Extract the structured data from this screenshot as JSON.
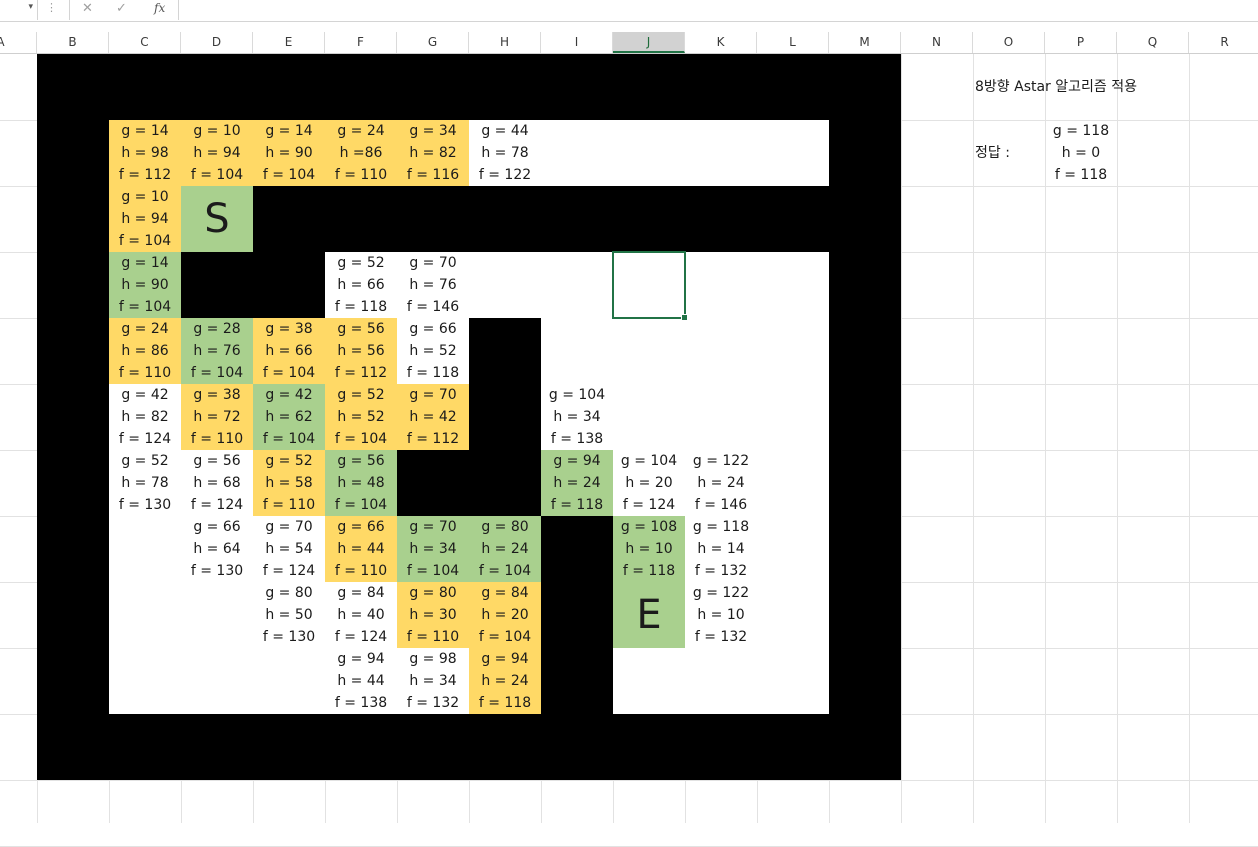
{
  "formula_bar": {
    "fx_label": "fx"
  },
  "columns": [
    "A",
    "B",
    "C",
    "D",
    "E",
    "F",
    "G",
    "H",
    "I",
    "J",
    "K",
    "L",
    "M",
    "N",
    "O",
    "P",
    "Q",
    "R"
  ],
  "selected_column": "J",
  "cells": {
    "C2": [
      "g = 14",
      "h = 98",
      "f = 112"
    ],
    "D2": [
      "g = 10",
      "h = 94",
      "f = 104"
    ],
    "E2": [
      "g = 14",
      "h = 90",
      "f = 104"
    ],
    "F2": [
      "g = 24",
      "h =86",
      "f = 110"
    ],
    "G2": [
      "g = 34",
      "h = 82",
      "f = 116"
    ],
    "H2": [
      "g = 44",
      "h = 78",
      "f = 122"
    ],
    "C3": [
      "g = 10",
      "h = 94",
      "f = 104"
    ],
    "D3": [
      "S"
    ],
    "C4": [
      "g = 14",
      "h = 90",
      "f = 104"
    ],
    "F4": [
      "g = 52",
      "h = 66",
      "f = 118"
    ],
    "G4": [
      "g = 70",
      "h = 76",
      "f = 146"
    ],
    "C5": [
      "g = 24",
      "h = 86",
      "f = 110"
    ],
    "D5": [
      "g = 28",
      "h = 76",
      "f = 104"
    ],
    "E5": [
      "g = 38",
      "h = 66",
      "f = 104"
    ],
    "F5": [
      "g = 56",
      "h = 56",
      "f = 112"
    ],
    "G5": [
      "g = 66",
      "h = 52",
      "f = 118"
    ],
    "C6": [
      "g = 42",
      "h = 82",
      "f = 124"
    ],
    "D6": [
      "g = 38",
      "h = 72",
      "f = 110"
    ],
    "E6": [
      "g = 42",
      "h = 62",
      "f = 104"
    ],
    "F6": [
      "g = 52",
      "h = 52",
      "f = 104"
    ],
    "G6": [
      "g = 70",
      "h = 42",
      "f = 112"
    ],
    "I6": [
      "g = 104",
      "h = 34",
      "f = 138"
    ],
    "C7": [
      "g = 52",
      "h = 78",
      "f = 130"
    ],
    "D7": [
      "g = 56",
      "h = 68",
      "f = 124"
    ],
    "E7": [
      "g = 52",
      "h = 58",
      "f = 110"
    ],
    "F7": [
      "g = 56",
      "h = 48",
      "f = 104"
    ],
    "I7": [
      "g = 94",
      "h = 24",
      "f = 118"
    ],
    "J7": [
      "g = 104",
      "h = 20",
      "f = 124"
    ],
    "K7": [
      "g = 122",
      "h = 24",
      "f = 146"
    ],
    "D8": [
      "g = 66",
      "h = 64",
      "f = 130"
    ],
    "E8": [
      "g = 70",
      "h = 54",
      "f = 124"
    ],
    "F8": [
      "g = 66",
      "h = 44",
      "f = 110"
    ],
    "G8": [
      "g = 70",
      "h = 34",
      "f = 104"
    ],
    "H8": [
      "g = 80",
      "h = 24",
      "f = 104"
    ],
    "J8": [
      "g = 108",
      "h = 10",
      "f = 118"
    ],
    "K8": [
      "g = 118",
      "h = 14",
      "f = 132"
    ],
    "E9": [
      "g = 80",
      "h = 50",
      "f = 130"
    ],
    "F9": [
      "g = 84",
      "h = 40",
      "f = 124"
    ],
    "G9": [
      "g = 80",
      "h = 30",
      "f = 110"
    ],
    "H9": [
      "g = 84",
      "h = 20",
      "f = 104"
    ],
    "J9": [
      "E"
    ],
    "K9": [
      "g = 122",
      "h = 10",
      "f = 132"
    ],
    "F10": [
      "g = 94",
      "h = 44",
      "f = 138"
    ],
    "G10": [
      "g = 98",
      "h = 34",
      "f = 132"
    ],
    "H10": [
      "g = 94",
      "h = 24",
      "f = 118"
    ]
  },
  "colors": {
    "wall": "#000000",
    "open_set": "#ffd966",
    "path": "#a9d08e",
    "unvisited": "#ffffff",
    "selection": "#217346"
  },
  "cell_colors": {
    "yellow": [
      "C2",
      "D2",
      "E2",
      "F2",
      "G2",
      "C3",
      "C5",
      "E5",
      "F5",
      "D6",
      "F6",
      "G6",
      "E7",
      "F8",
      "G9",
      "H9",
      "H10"
    ],
    "green": [
      "D3",
      "C4",
      "D5",
      "E6",
      "F7",
      "I7",
      "G8",
      "H8",
      "J8",
      "J9"
    ],
    "white": [
      "H2",
      "F4",
      "G4",
      "G5",
      "C6",
      "I6",
      "C7",
      "D7",
      "J7",
      "K7",
      "D8",
      "E8",
      "K8",
      "E9",
      "F9",
      "K9",
      "F10",
      "G10"
    ]
  },
  "notes": {
    "title": "8방향 Astar 알고리즘 적용",
    "answer_label": "정답 :",
    "answer_values": [
      "g = 118",
      "h = 0",
      "f = 118"
    ]
  }
}
